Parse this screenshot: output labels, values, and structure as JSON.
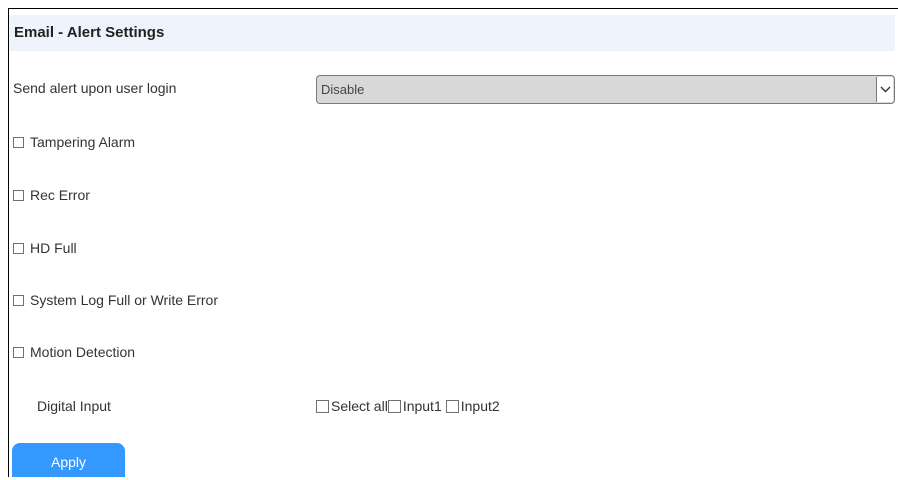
{
  "header": {
    "title": "Email - Alert Settings"
  },
  "login_alert": {
    "label": "Send alert upon user login",
    "value": "Disable"
  },
  "alarms": [
    {
      "label": "Tampering Alarm",
      "checked": false
    },
    {
      "label": "Rec Error",
      "checked": false
    },
    {
      "label": "HD Full",
      "checked": false
    },
    {
      "label": "System Log Full or Write Error",
      "checked": false
    },
    {
      "label": "Motion Detection",
      "checked": false
    }
  ],
  "digital_input": {
    "label": "Digital Input",
    "select_all": "Select all",
    "input1": "Input1",
    "input2": "Input2"
  },
  "actions": {
    "apply_label": "Apply"
  },
  "colors": {
    "header_bg": "#eef3fc",
    "button_bg": "#3399ff"
  }
}
